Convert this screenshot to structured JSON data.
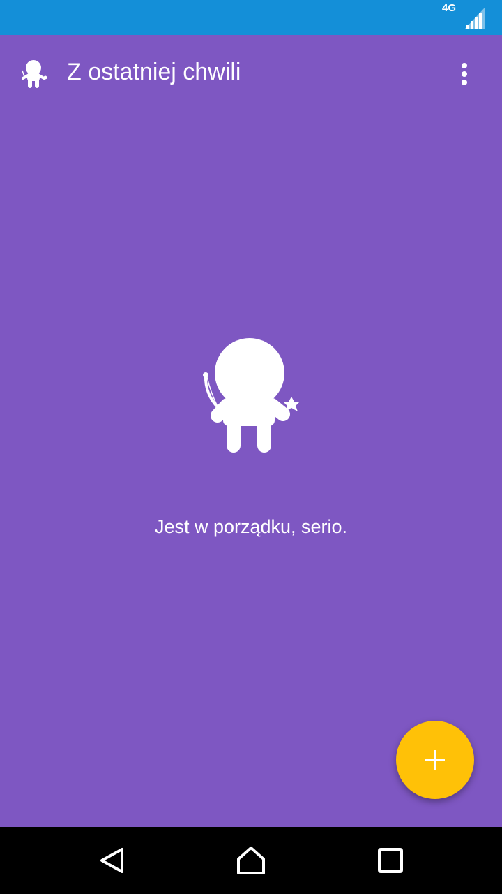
{
  "status_bar": {
    "network_type": "4G",
    "signal_icon": "signal-strength-icon",
    "color": "#148FD8"
  },
  "app_bar": {
    "title": "Z ostatniej chwili",
    "logo_icon": "character-logo-icon",
    "overflow_icon": "more-vert-icon"
  },
  "empty_state": {
    "illustration": "character-illustration-icon",
    "message": "Jest w porządku, serio."
  },
  "fab": {
    "icon": "plus-icon",
    "color": "#FFC107"
  },
  "nav_bar": {
    "back_icon": "back-triangle-icon",
    "home_icon": "home-icon",
    "recents_icon": "recents-square-icon"
  },
  "theme": {
    "background": "#7E57C2"
  }
}
